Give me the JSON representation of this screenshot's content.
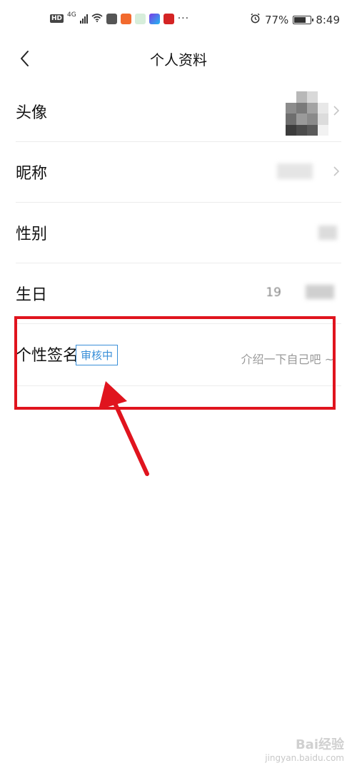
{
  "status_bar": {
    "left_badge": "HD",
    "network": "4G",
    "more": "···",
    "battery": "77%",
    "battery_level": 0.77,
    "time": "8:49"
  },
  "header": {
    "title": "个人资料"
  },
  "rows": [
    {
      "label": "头像"
    },
    {
      "label": "昵称"
    },
    {
      "label": "性别"
    },
    {
      "label": "生日",
      "value": "19"
    },
    {
      "label": "个性签名",
      "badge": "审核中",
      "value": "介绍一下自己吧 ~"
    }
  ],
  "watermark": {
    "logo": "Bai经验",
    "url": "jingyan.baidu.com"
  },
  "colors": {
    "annotation_red": "#e0141e",
    "badge_blue": "#3a8fd8"
  }
}
